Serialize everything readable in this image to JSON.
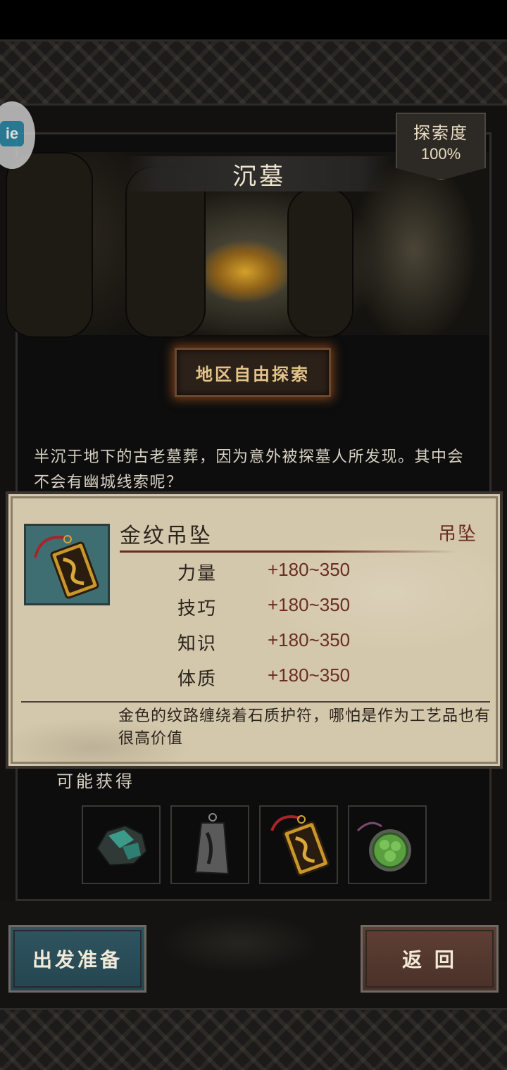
{
  "location": {
    "title": "沉墓",
    "explore_label": "探索度",
    "explore_value": "100%"
  },
  "free_explore_button": "地区自由探索",
  "description": "半沉于地下的古老墓葬，因为意外被探墓人所发现。其中会不会有幽城线索呢？",
  "loot": {
    "title": "可能获得",
    "items": [
      {
        "name": "ore-item-icon"
      },
      {
        "name": "iron-pendant-item-icon"
      },
      {
        "name": "gold-pendant-item-icon"
      },
      {
        "name": "jade-pendant-item-icon"
      }
    ]
  },
  "tooltip": {
    "name": "金纹吊坠",
    "type": "吊坠",
    "stats": [
      {
        "name": "力量",
        "value": "+180~350"
      },
      {
        "name": "技巧",
        "value": "+180~350"
      },
      {
        "name": "知识",
        "value": "+180~350"
      },
      {
        "name": "体质",
        "value": "+180~350"
      }
    ],
    "description": "金色的纹路缠绕着石质护符，哪怕是作为工艺品也有很高价值"
  },
  "buttons": {
    "prepare": "出发准备",
    "back": "返 回"
  },
  "side_bubble": "ie",
  "colors": {
    "accent_red": "#6b2c22",
    "glow_orange": "#d66e28",
    "prepare_blue": "#2f5560",
    "back_brown": "#5e3f34"
  }
}
